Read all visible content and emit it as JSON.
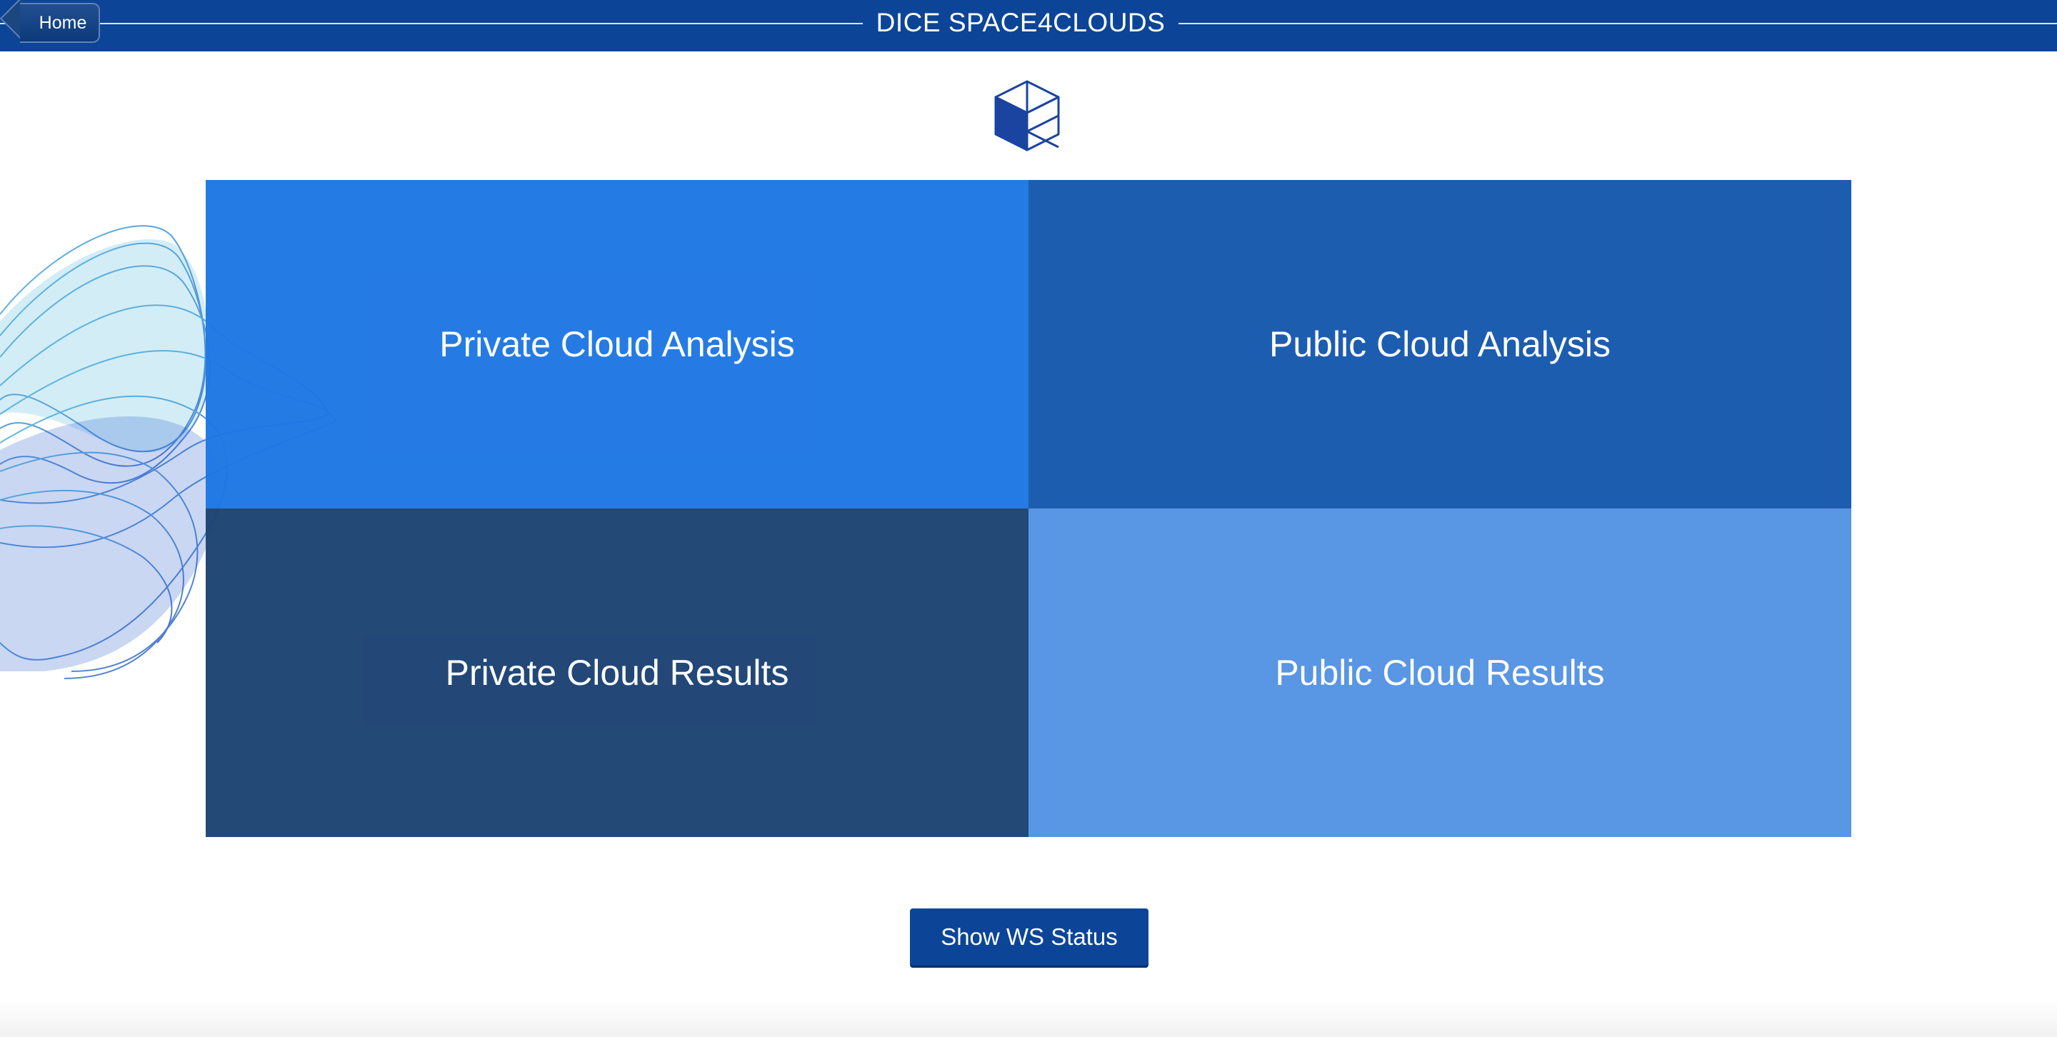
{
  "header": {
    "title": "DICE SPACE4CLOUDS",
    "home_label": "Home",
    "background": "#0c4598"
  },
  "logo": {
    "icon": "cube-icon"
  },
  "tiles": [
    {
      "label": "Private Cloud Analysis",
      "color": "#1e77e3"
    },
    {
      "label": "Public Cloud Analysis",
      "color": "#1d5db0"
    },
    {
      "label": "Private Cloud Results",
      "color": "#1c4373"
    },
    {
      "label": "Public Cloud Results",
      "color": "#5996e3"
    }
  ],
  "ws_button": {
    "label": "Show WS Status",
    "color": "#0c4598"
  }
}
